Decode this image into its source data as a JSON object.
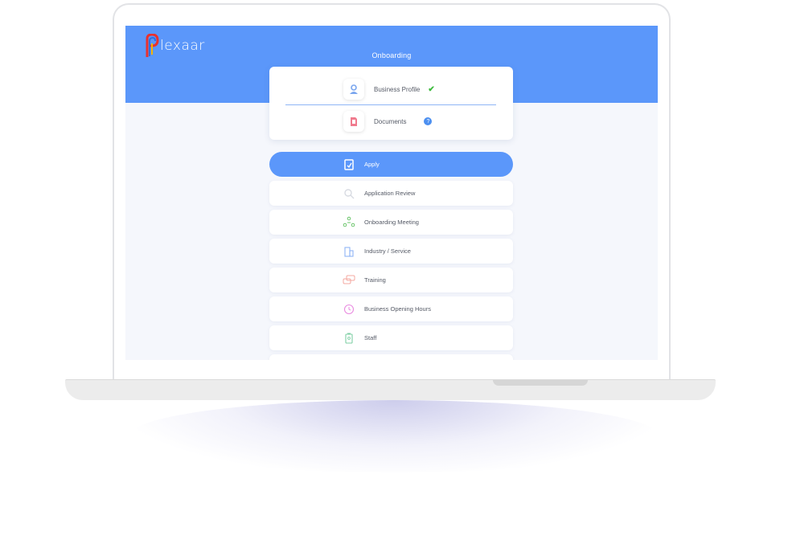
{
  "app": {
    "logo_text": "lexaar",
    "brand_color": "#5b97fa"
  },
  "header": {
    "title": "Onboarding"
  },
  "onboarding_card": {
    "items": [
      {
        "label": "Business Profile",
        "icon": "user-profile-icon",
        "status": "complete"
      },
      {
        "label": "Documents",
        "icon": "document-icon",
        "status": "info"
      }
    ]
  },
  "steps": [
    {
      "label": "Apply",
      "icon": "clipboard-icon",
      "active": true
    },
    {
      "label": "Application Review",
      "icon": "search-icon",
      "active": false
    },
    {
      "label": "Onboarding Meeting",
      "icon": "team-meeting-icon",
      "active": false
    },
    {
      "label": "Industry / Service",
      "icon": "building-icon",
      "active": false
    },
    {
      "label": "Training",
      "icon": "chat-bubbles-icon",
      "active": false
    },
    {
      "label": "Business Opening Hours",
      "icon": "clock-icon",
      "active": false
    },
    {
      "label": "Staff",
      "icon": "id-badge-icon",
      "active": false
    }
  ]
}
